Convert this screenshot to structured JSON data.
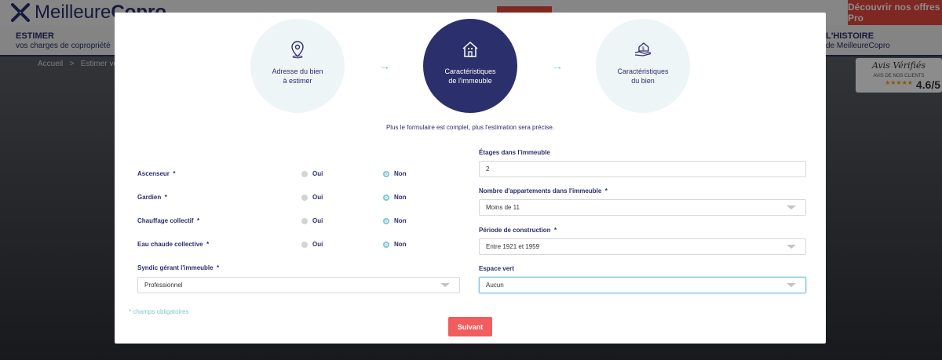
{
  "site": {
    "logo_light": "Meilleure",
    "logo_bold": "Copro",
    "pro_button": "Découvrir nos offres Pro",
    "nav_left_title": "ESTIMER",
    "nav_left_sub": "vos charges de copropriété",
    "nav_right_title": "L'HISTOIRE",
    "nav_right_sub": "de MeilleureCopro",
    "breadcrumb_home": "Accueil",
    "breadcrumb_sep": ">",
    "breadcrumb_current": "Estimer vo",
    "avis_title": "Avis Vérifiés",
    "avis_sub": "AVIS DE NOS CLIENTS",
    "avis_stars": "★★★★★",
    "avis_score": "4.6/5"
  },
  "steps": [
    {
      "label_1": "Adresse du bien",
      "label_2": "à estimer",
      "icon": "location-pin-icon"
    },
    {
      "label_1": "Caractéristiques",
      "label_2": "de l'immeuble",
      "icon": "building-icon"
    },
    {
      "label_1": "Caractéristiques",
      "label_2": "du bien",
      "icon": "hand-house-icon"
    }
  ],
  "arrow": "→",
  "hint": "Plus le formulaire est complet, plus l'estimation sera précise.",
  "questions": [
    {
      "label": "Ascenseur",
      "req": "*",
      "oui": "Oui",
      "non": "Non",
      "selected": "Non"
    },
    {
      "label": "Gardien",
      "req": "*",
      "oui": "Oui",
      "non": "Non",
      "selected": "Non"
    },
    {
      "label": "Chauffage collectif",
      "req": "*",
      "oui": "Oui",
      "non": "Non",
      "selected": "Non"
    },
    {
      "label": "Eau chaude collective",
      "req": "*",
      "oui": "Oui",
      "non": "Non",
      "selected": "Non"
    }
  ],
  "syndic": {
    "label": "Syndic gérant l'immeuble",
    "req": "*",
    "value": "Professionnel"
  },
  "etages": {
    "label": "Étages dans l'immeuble",
    "value": "2"
  },
  "appartements": {
    "label": "Nombre d'appartements dans l'immeuble",
    "req": "*",
    "value": "Moins de 11"
  },
  "periode": {
    "label": "Période de construction",
    "req": "*",
    "value": "Entre 1921 et 1959"
  },
  "espace": {
    "label": "Espace vert",
    "value": "Aucun"
  },
  "mandatory_note": "* champs obligatoires",
  "submit": "Suivant",
  "colors": {
    "navy": "#2b2f6b",
    "teal": "#7fc6d6",
    "red": "#f25c5c"
  }
}
